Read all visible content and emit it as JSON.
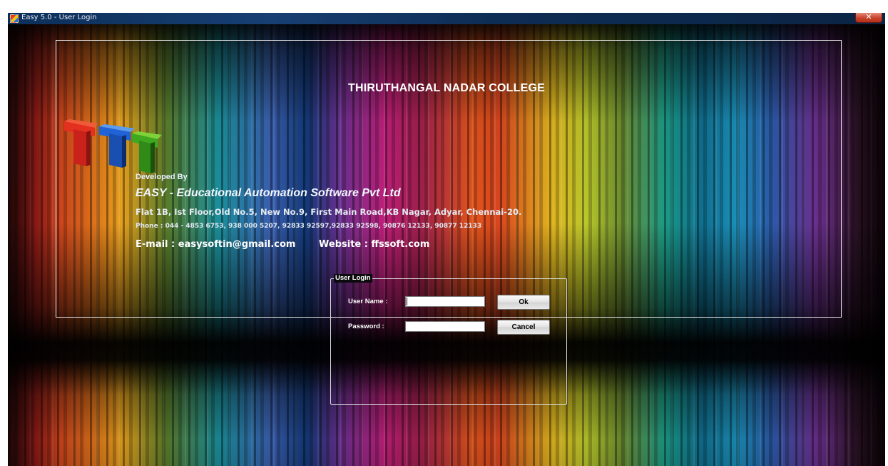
{
  "window": {
    "title": "Easy 5.0 - User Login",
    "close_label": "✕"
  },
  "header": {
    "college_name": "THIRUTHANGAL NADAR COLLEGE"
  },
  "developer": {
    "developed_by": "Developed By",
    "company": "EASY - Educational Automation Software Pvt Ltd",
    "address": "Flat 1B, Ist Floor,Old No.5, New No.9, First Main Road,KB Nagar, Adyar, Chennai-20.",
    "phone": "Phone : 044 - 4853 6753, 938 000 5207, 92833 92597,92833 92598, 90876  12133, 90877 12133",
    "email": "E-mail : easysoftin@gmail.com",
    "website": "Website : ffssoft.com"
  },
  "login": {
    "group_title": "User Login",
    "username_label": "User Name :",
    "username_value": "",
    "password_label": "Password  :",
    "password_value": "",
    "ok_label": "Ok",
    "cancel_label": "Cancel"
  },
  "icons": {
    "app": "app-icon",
    "logo": "ttt-logo-icon"
  }
}
